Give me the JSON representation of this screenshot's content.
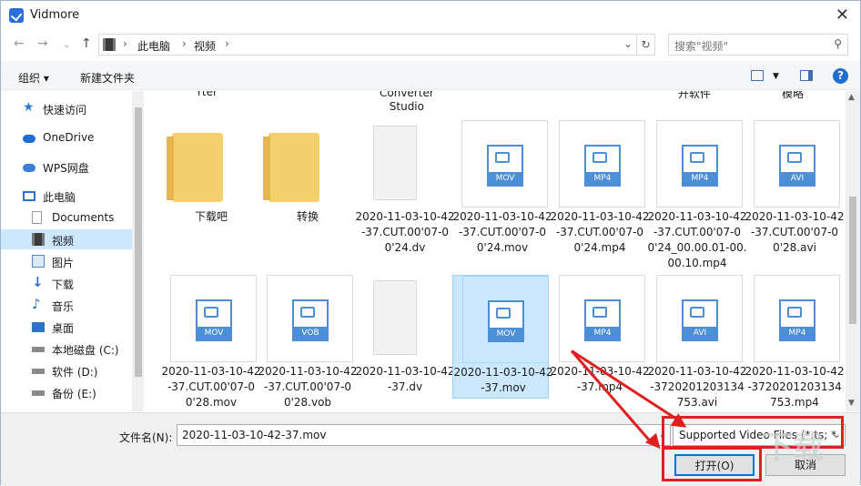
{
  "window": {
    "title": "Vidmore"
  },
  "address": {
    "crumbs": [
      "此电脑",
      "视频"
    ]
  },
  "search": {
    "placeholder": "搜索\"视频\""
  },
  "toolbar": {
    "organize": "组织 ▾",
    "new_folder": "新建文件夹"
  },
  "sidebar": {
    "items": [
      {
        "label": "快速访问",
        "icon": "star-icon"
      },
      {
        "label": "OneDrive",
        "icon": "cloud-icon"
      },
      {
        "label": "WPS网盘",
        "icon": "cloud-icon"
      },
      {
        "label": "此电脑",
        "icon": "computer-icon"
      },
      {
        "label": "Documents",
        "icon": "document-icon"
      },
      {
        "label": "视频",
        "icon": "video-folder-icon"
      },
      {
        "label": "图片",
        "icon": "picture-icon"
      },
      {
        "label": "下载",
        "icon": "download-icon"
      },
      {
        "label": "音乐",
        "icon": "music-icon"
      },
      {
        "label": "桌面",
        "icon": "desktop-icon"
      },
      {
        "label": "本地磁盘 (C:)",
        "icon": "drive-icon"
      },
      {
        "label": "软件 (D:)",
        "icon": "drive-icon"
      },
      {
        "label": "备份 (E:)",
        "icon": "drive-icon"
      }
    ]
  },
  "partial_labels": [
    "rter",
    "Converter\nStudio",
    "开软件",
    "模略"
  ],
  "files": [
    {
      "name": "下载吧",
      "kind": "folder"
    },
    {
      "name": "转换",
      "kind": "folder"
    },
    {
      "name": "2020-11-03-10-42-37.CUT.00'07-00'24.dv",
      "kind": "blank"
    },
    {
      "name": "2020-11-03-10-42-37.CUT.00'07-00'24.mov",
      "kind": "video",
      "badge": "MOV"
    },
    {
      "name": "2020-11-03-10-42-37.CUT.00'07-00'24.mp4",
      "kind": "video",
      "badge": "MP4"
    },
    {
      "name": "2020-11-03-10-42-37.CUT.00'07-00'24_00.00.01-00.00.10.mp4",
      "kind": "video",
      "badge": "MP4"
    },
    {
      "name": "2020-11-03-10-42-37.CUT.00'07-00'28.avi",
      "kind": "video",
      "badge": "AVI"
    },
    {
      "name": "2020-11-03-10-42-37.CUT.00'07-00'28.mov",
      "kind": "video",
      "badge": "MOV"
    },
    {
      "name": "2020-11-03-10-42-37.CUT.00'07-00'28.vob",
      "kind": "video",
      "badge": "VOB"
    },
    {
      "name": "2020-11-03-10-42-37.dv",
      "kind": "blank"
    },
    {
      "name": "2020-11-03-10-42-37.mov",
      "kind": "video",
      "badge": "MOV",
      "selected": true
    },
    {
      "name": "2020-11-03-10-42-37.mp4",
      "kind": "video",
      "badge": "MP4"
    },
    {
      "name": "2020-11-03-10-42-3720201203134753.avi",
      "kind": "video",
      "badge": "AVI"
    },
    {
      "name": "2020-11-03-10-42-3720201203134753.mp4",
      "kind": "video",
      "badge": "MP4"
    }
  ],
  "footer": {
    "filename_label": "文件名(N):",
    "filename_value": "2020-11-03-10-42-37.mov",
    "filter": "Supported Video Files (*.ts; *",
    "open": "打开(O)",
    "cancel": "取消"
  },
  "colors": {
    "accent": "#0078d7",
    "highlight": "#e02020",
    "selection": "#cce8ff",
    "video_icon": "#4c8fd6"
  }
}
